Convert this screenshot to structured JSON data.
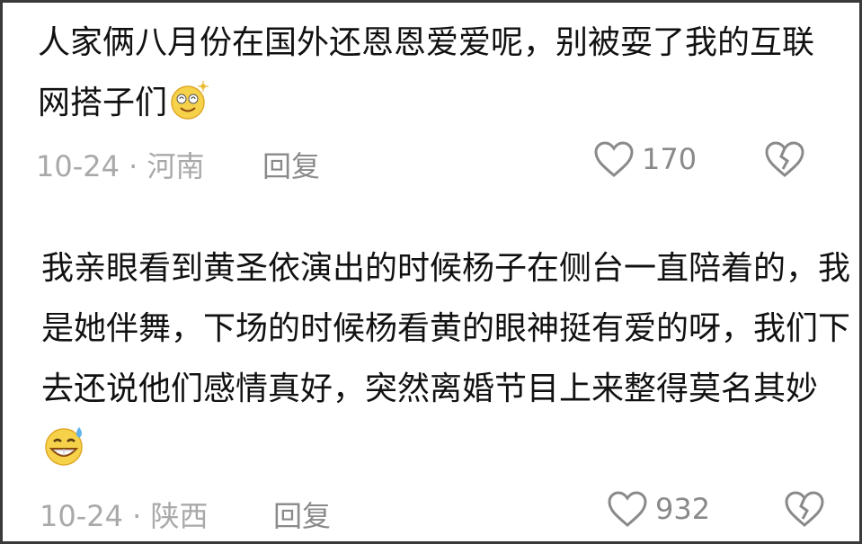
{
  "comments": [
    {
      "text": "人家俩八月份在国外还恩恩爱爱呢，别被耍了我的互联网搭子们",
      "emoji": "dizzy-smile-emoji",
      "date_location": "10-24 · 河南",
      "reply_label": "回复",
      "likes": "170"
    },
    {
      "text": "我亲眼看到黄圣依演出的时候杨子在侧台一直陪着的，我是她伴舞，下场的时候杨看黄的眼神挺有爱的呀，我们下去还说他们感情真好，突然离婚节目上来整得莫名其妙",
      "emoji": "grin-sweat-emoji",
      "date_location": "10-24 · 陕西",
      "reply_label": "回复",
      "likes": "932"
    }
  ],
  "colors": {
    "text": "#111111",
    "meta": "#a9a9a9",
    "icon": "#8a8a8a",
    "border": "#3a3a3a"
  }
}
